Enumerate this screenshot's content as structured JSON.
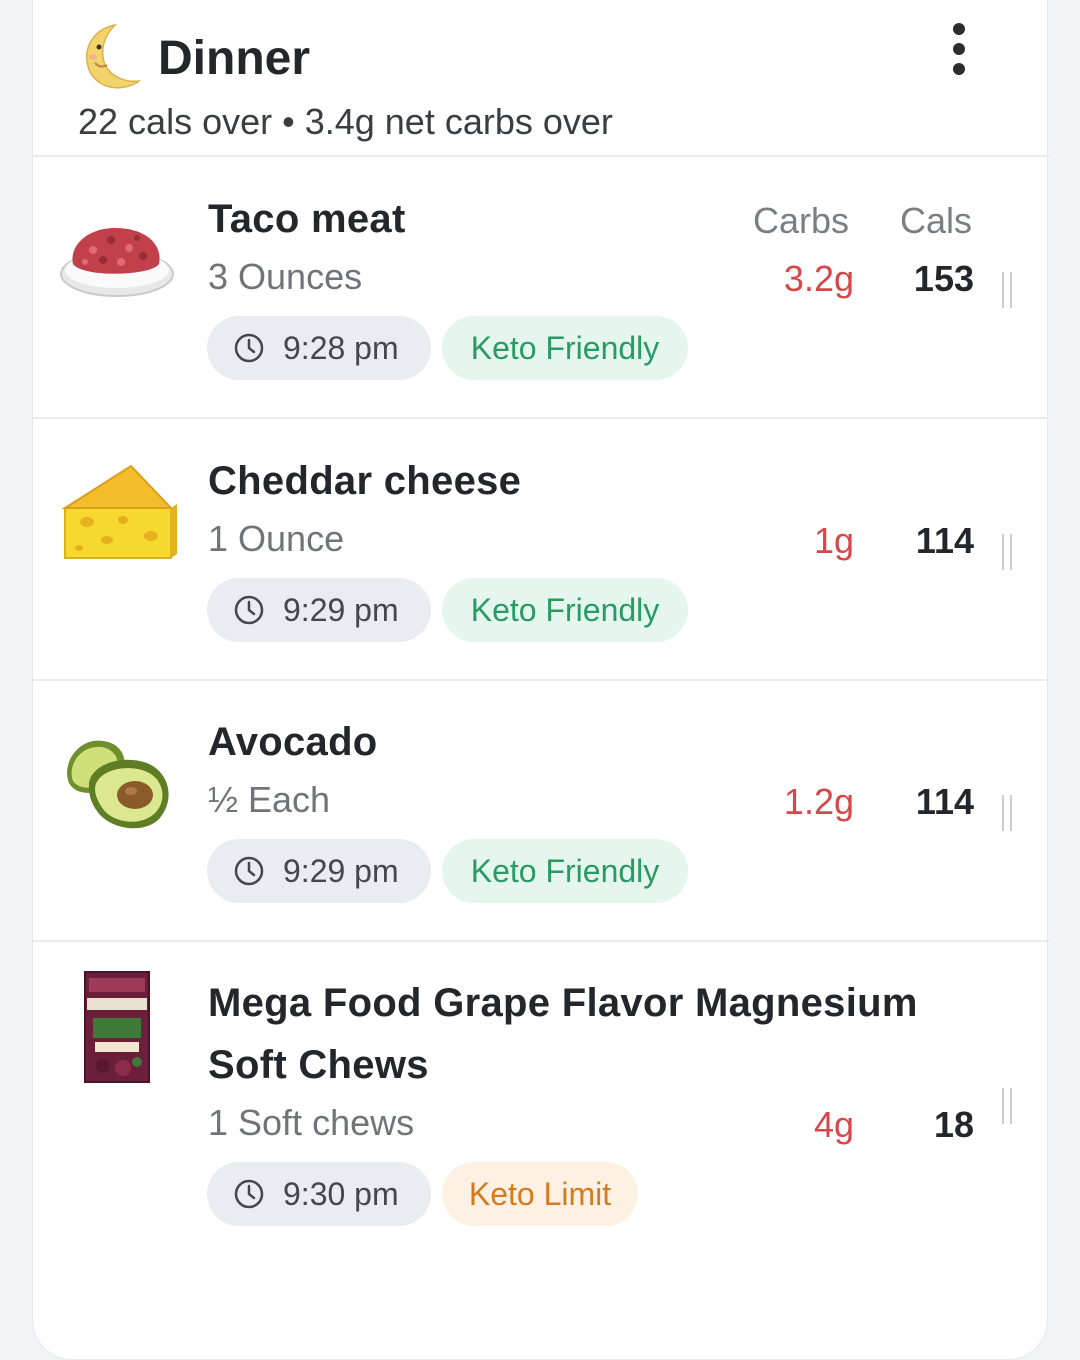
{
  "meal": {
    "title": "Dinner",
    "summary": "22 cals over • 3.4g net carbs over",
    "icon": "crescent-moon-face-icon"
  },
  "columns": {
    "carbs_label": "Carbs",
    "cals_label": "Cals"
  },
  "colors": {
    "carbs_over": "#d6474a",
    "keto_friendly_bg": "#e5f6ef",
    "keto_friendly_text": "#2a9a63",
    "keto_limit_bg": "#fdf1e3",
    "keto_limit_text": "#d47a1f"
  },
  "items": [
    {
      "name": "Taco meat",
      "amount": "3 Ounces",
      "carbs": "3.2g",
      "cals": "153",
      "time": "9:28 pm",
      "tag": "Keto Friendly",
      "icon": "ground-meat-icon"
    },
    {
      "name": "Cheddar cheese",
      "amount": "1 Ounce",
      "carbs": "1g",
      "cals": "114",
      "time": "9:29 pm",
      "tag": "Keto Friendly",
      "icon": "cheese-wedge-icon"
    },
    {
      "name": "Avocado",
      "amount": "½ Each",
      "carbs": "1.2g",
      "cals": "114",
      "time": "9:29 pm",
      "tag": "Keto Friendly",
      "icon": "avocado-icon"
    },
    {
      "name": "Mega Food Grape Flavor Magnesium Soft Chews",
      "amount": "1 Soft chews",
      "carbs": "4g",
      "cals": "18",
      "time": "9:30 pm",
      "tag": "Keto Limit",
      "icon": "product-package-icon"
    }
  ]
}
